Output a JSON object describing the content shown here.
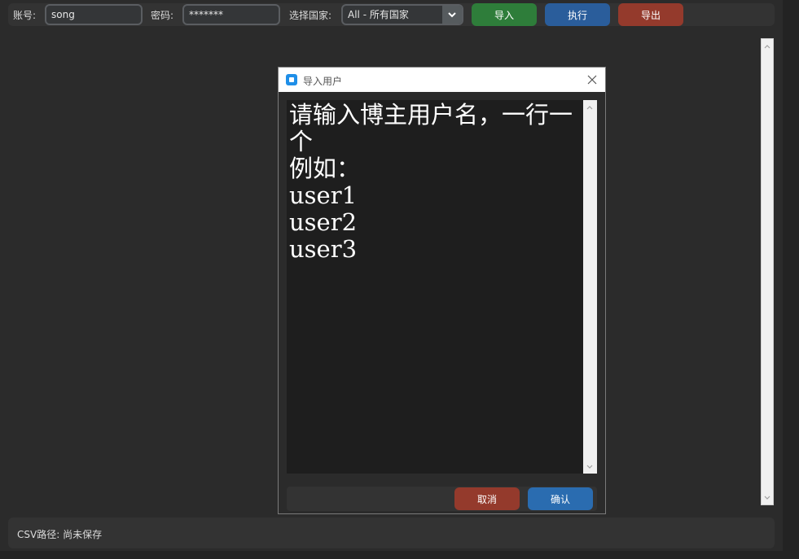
{
  "toolbar": {
    "account_label": "账号:",
    "account_value": "song",
    "password_label": "密码:",
    "password_value": "*******",
    "country_label": "选择国家:",
    "country_value": "All - 所有国家",
    "import_label": "导入",
    "run_label": "执行",
    "export_label": "导出"
  },
  "status": {
    "csv_path": "CSV路径: 尚未保存"
  },
  "dialog": {
    "title": "导入用户",
    "text": "请输入博主用户名，一行一个\n例如：\nuser1\nuser2\nuser3",
    "cancel_label": "取消",
    "confirm_label": "确认"
  },
  "colors": {
    "import": "#2e7d3a",
    "run": "#2a5d9b",
    "export": "#943a2c",
    "cancel": "#943a2c",
    "confirm": "#2a6cb0",
    "window_bg": "#2b2b2b"
  }
}
